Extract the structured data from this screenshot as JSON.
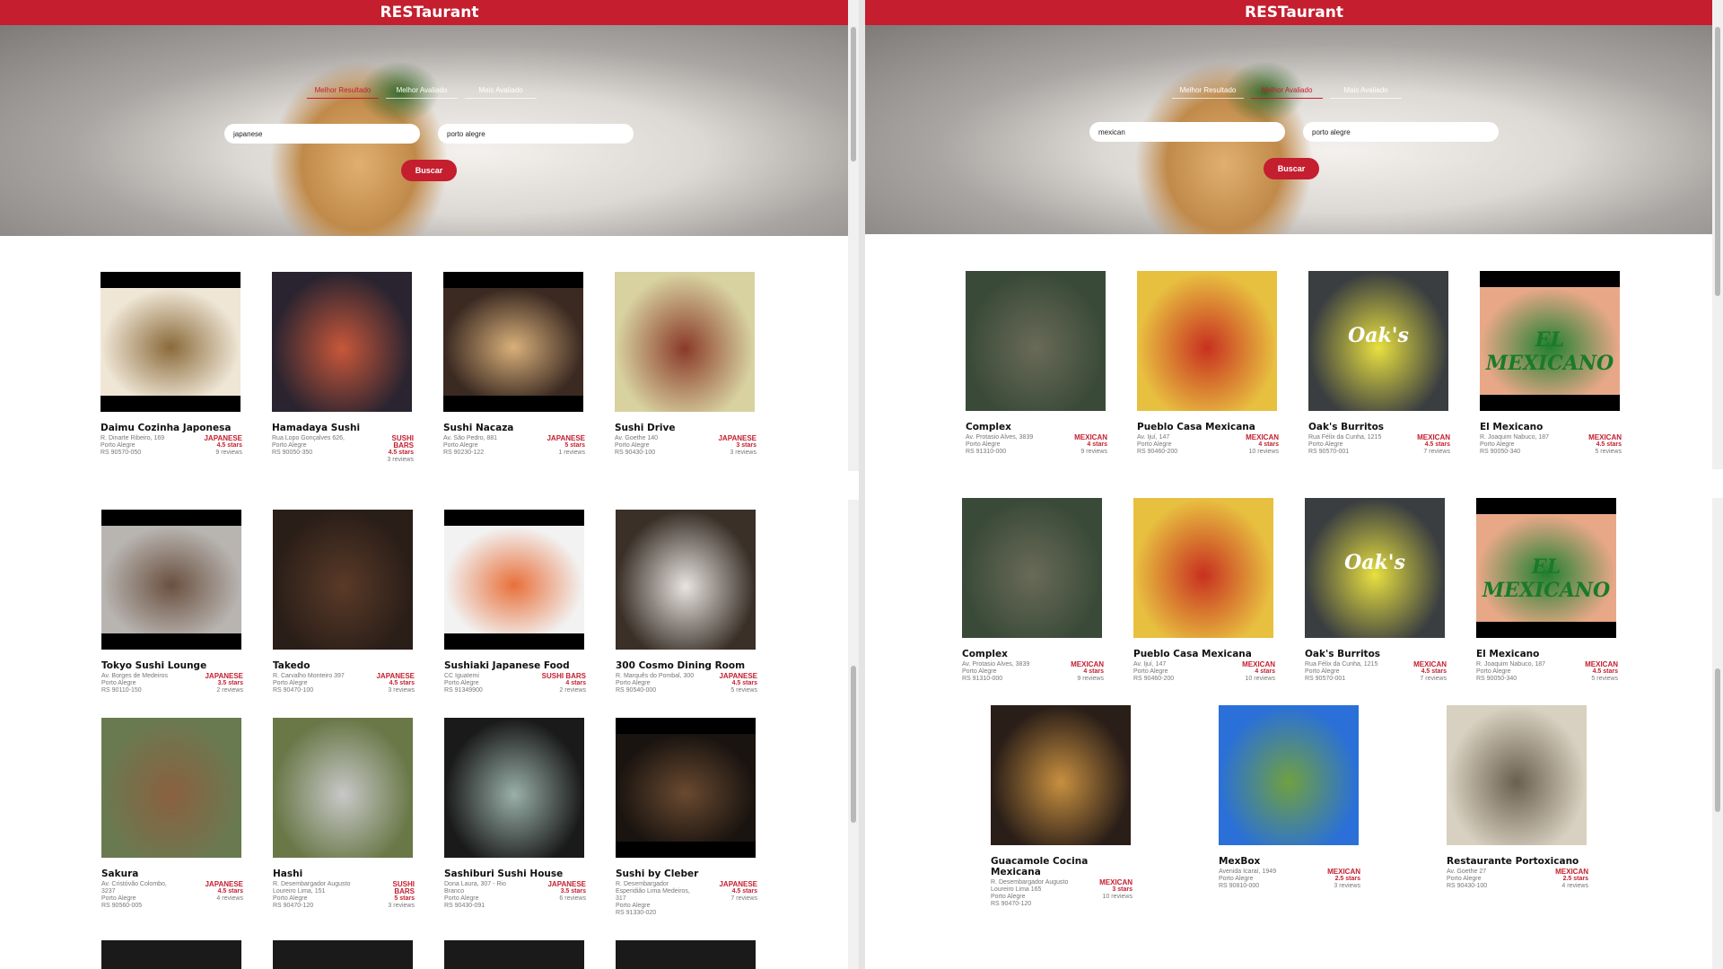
{
  "app": {
    "title": "RESTaurant"
  },
  "colors": {
    "brand": "#c41e2f"
  },
  "tabs": [
    "Melhor Resultado",
    "Melhor Avaliado",
    "Mais Avaliado"
  ],
  "left": {
    "search": {
      "food": "japanese",
      "location": "porto alegre",
      "button": "Buscar"
    },
    "active_tab": 0,
    "cards": [
      {
        "name": "Daimu Cozinha Japonesa",
        "addr": [
          "R. Dinarte Ribeiro, 169",
          "Porto Alegre",
          "RS 90570-050"
        ],
        "cuisine": [
          "JAPANESE"
        ],
        "stars": "4.5 stars",
        "reviews": "9 reviews",
        "tint": [
          "#efe6d6",
          "#8a6a3a"
        ]
      },
      {
        "name": "Hamadaya Sushi",
        "addr": [
          "Rua Lopo Gonçalves 626,",
          "Porto Alegre",
          "RS 90050-350"
        ],
        "cuisine": [
          "SUSHI",
          "BARS"
        ],
        "stars": "4.5 stars",
        "reviews": "3 reviews",
        "tint": [
          "#2a2430",
          "#c8573a"
        ]
      },
      {
        "name": "Sushi Nacaza",
        "addr": [
          "Av. São Pedro, 881",
          "Porto Alegre",
          "RS 90230-122"
        ],
        "cuisine": [
          "JAPANESE"
        ],
        "stars": "5 stars",
        "reviews": "1 reviews",
        "tint": [
          "#3b2a22",
          "#d9b07a"
        ]
      },
      {
        "name": "Sushi Drive",
        "addr": [
          "Av. Goethe 140",
          "Porto Alegre",
          "RS 90430-100"
        ],
        "cuisine": [
          "JAPANESE"
        ],
        "stars": "3 stars",
        "reviews": "3 reviews",
        "tint": [
          "#d8d2a0",
          "#8a3a2a"
        ]
      },
      {
        "name": "Tokyo Sushi Lounge",
        "addr": [
          "Av. Borges de Medeiros",
          "Porto Alegre",
          "RS 90110-150"
        ],
        "cuisine": [
          "JAPANESE"
        ],
        "stars": "3.5 stars",
        "reviews": "2 reviews",
        "tint": [
          "#b8b4b0",
          "#6a5040"
        ]
      },
      {
        "name": "Takedo",
        "addr": [
          "R. Carvalho Monteiro 397",
          "Porto Alegre",
          "RS 90470-100"
        ],
        "cuisine": [
          "JAPANESE"
        ],
        "stars": "4.5 stars",
        "reviews": "3 reviews",
        "tint": [
          "#2a1e18",
          "#5a3a28"
        ]
      },
      {
        "name": "Sushiaki Japanese Food",
        "addr": [
          "CC Iguatemi",
          "Porto Alegre",
          "RS 91349900"
        ],
        "cuisine": [
          "SUSHI BARS"
        ],
        "stars": "4 stars",
        "reviews": "2 reviews",
        "tint": [
          "#f2f2f2",
          "#e8703a"
        ]
      },
      {
        "name": "300 Cosmo Dining Room",
        "addr": [
          "R. Marquês do Pombal, 300",
          "Porto Alegre",
          "RS 90540-000"
        ],
        "cuisine": [
          "JAPANESE"
        ],
        "stars": "4.5 stars",
        "reviews": "5 reviews",
        "tint": [
          "#3a3028",
          "#e8e4e0"
        ]
      },
      {
        "name": "Sakura",
        "addr": [
          "Av. Cristóvão Colombo,",
          "3237",
          "Porto Alegre",
          "RS 90560-005"
        ],
        "cuisine": [
          "JAPANESE"
        ],
        "stars": "4.5 stars",
        "reviews": "4 reviews",
        "tint": [
          "#6a7a50",
          "#8a6040"
        ]
      },
      {
        "name": "Hashi",
        "addr": [
          "R. Desembargador Augusto",
          "Loureiro Lima, 151",
          "Porto Alegre",
          "RS 90470-120"
        ],
        "cuisine": [
          "SUSHI",
          "BARS"
        ],
        "stars": "5 stars",
        "reviews": "3 reviews",
        "tint": [
          "#6a7848",
          "#c8c8c8"
        ]
      },
      {
        "name": "Sashiburi Sushi House",
        "addr": [
          "Dona Laura, 307 - Rio",
          "Branco",
          "Porto Alegre",
          "RS 90430-091"
        ],
        "cuisine": [
          "JAPANESE"
        ],
        "stars": "3.5 stars",
        "reviews": "6 reviews",
        "tint": [
          "#1a1a1a",
          "#9ab0a8"
        ]
      },
      {
        "name": "Sushi by Cleber",
        "addr": [
          "R. Desembargador",
          "Esperidião Lima Medeiros,",
          "317",
          "Porto Alegre",
          "RS 91330-020"
        ],
        "cuisine": [
          "JAPANESE"
        ],
        "stars": "4.5 stars",
        "reviews": "7 reviews",
        "tint": [
          "#1a1410",
          "#6a4a30"
        ]
      }
    ]
  },
  "right": {
    "search": {
      "food": "mexican",
      "location": "porto alegre",
      "button": "Buscar"
    },
    "active_tab": 1,
    "cards": [
      {
        "name": "Complex",
        "addr": [
          "Av. Protasio Alves, 3839",
          "Porto Alegre",
          "RS 91310-000"
        ],
        "cuisine": [
          "MEXICAN"
        ],
        "stars": "4 stars",
        "reviews": "9 reviews",
        "tint": [
          "#3a4a38",
          "#6a6a58"
        ]
      },
      {
        "name": "Pueblo Casa Mexicana",
        "addr": [
          "Av. Ijuí, 147",
          "Porto Alegre",
          "RS 90460-200"
        ],
        "cuisine": [
          "MEXICAN"
        ],
        "stars": "4 stars",
        "reviews": "10 reviews",
        "tint": [
          "#e8c040",
          "#c83020"
        ]
      },
      {
        "name": "Oak's Burritos",
        "addr": [
          "Rua Félix da Cunha, 1215",
          "Porto Alegre",
          "RS 90570-001"
        ],
        "cuisine": [
          "MEXICAN"
        ],
        "stars": "4.5 stars",
        "reviews": "7 reviews",
        "tint": [
          "#3a3e40",
          "#e8e040"
        ],
        "logo": "Oak's"
      },
      {
        "name": "El Mexicano",
        "addr": [
          "R. Joaquim Nabuco, 187",
          "Porto Alegre",
          "RS 90050-340"
        ],
        "cuisine": [
          "MEXICAN"
        ],
        "stars": "4.5 stars",
        "reviews": "5 reviews",
        "tint": [
          "#e8a888",
          "#208030"
        ],
        "logo": "EL MEXICANO"
      },
      {
        "name": "Complex",
        "addr": [
          "Av. Protasio Alves, 3839",
          "Porto Alegre",
          "RS 91310-000"
        ],
        "cuisine": [
          "MEXICAN"
        ],
        "stars": "4 stars",
        "reviews": "9 reviews",
        "tint": [
          "#3a4a38",
          "#6a6a58"
        ]
      },
      {
        "name": "Pueblo Casa Mexicana",
        "addr": [
          "Av. Ijuí, 147",
          "Porto Alegre",
          "RS 90460-200"
        ],
        "cuisine": [
          "MEXICAN"
        ],
        "stars": "4 stars",
        "reviews": "10 reviews",
        "tint": [
          "#e8c040",
          "#c83020"
        ]
      },
      {
        "name": "Oak's Burritos",
        "addr": [
          "Rua Félix da Cunha, 1215",
          "Porto Alegre",
          "RS 90570-001"
        ],
        "cuisine": [
          "MEXICAN"
        ],
        "stars": "4.5 stars",
        "reviews": "7 reviews",
        "tint": [
          "#3a3e40",
          "#e8e040"
        ],
        "logo": "Oak's"
      },
      {
        "name": "El Mexicano",
        "addr": [
          "R. Joaquim Nabuco, 187",
          "Porto Alegre",
          "RS 90050-340"
        ],
        "cuisine": [
          "MEXICAN"
        ],
        "stars": "4.5 stars",
        "reviews": "5 reviews",
        "tint": [
          "#e8a888",
          "#208030"
        ],
        "logo": "EL MEXICANO"
      },
      {
        "name": "Guacamole Cocina Mexicana",
        "addr": [
          "R. Desembargador Augusto",
          "Loureiro Lima 165",
          "Porto Alegre",
          "RS 90470-120"
        ],
        "cuisine": [
          "MEXICAN"
        ],
        "stars": "3 stars",
        "reviews": "10 reviews",
        "tint": [
          "#2a1e18",
          "#c89040"
        ]
      },
      {
        "name": "MexBox",
        "addr": [
          "Avenida Icaraí, 1949",
          "Porto Alegre",
          "RS 90810-000"
        ],
        "cuisine": [
          "MEXICAN"
        ],
        "stars": "2.5 stars",
        "reviews": "3 reviews",
        "tint": [
          "#2a70d8",
          "#70a040"
        ]
      },
      {
        "name": "Restaurante Portoxicano",
        "addr": [
          "Av. Goethe 27",
          "Porto Alegre",
          "RS 90430-100"
        ],
        "cuisine": [
          "MEXICAN"
        ],
        "stars": "2.5 stars",
        "reviews": "4 reviews",
        "tint": [
          "#d8d0c0",
          "#6a6050"
        ]
      }
    ]
  }
}
